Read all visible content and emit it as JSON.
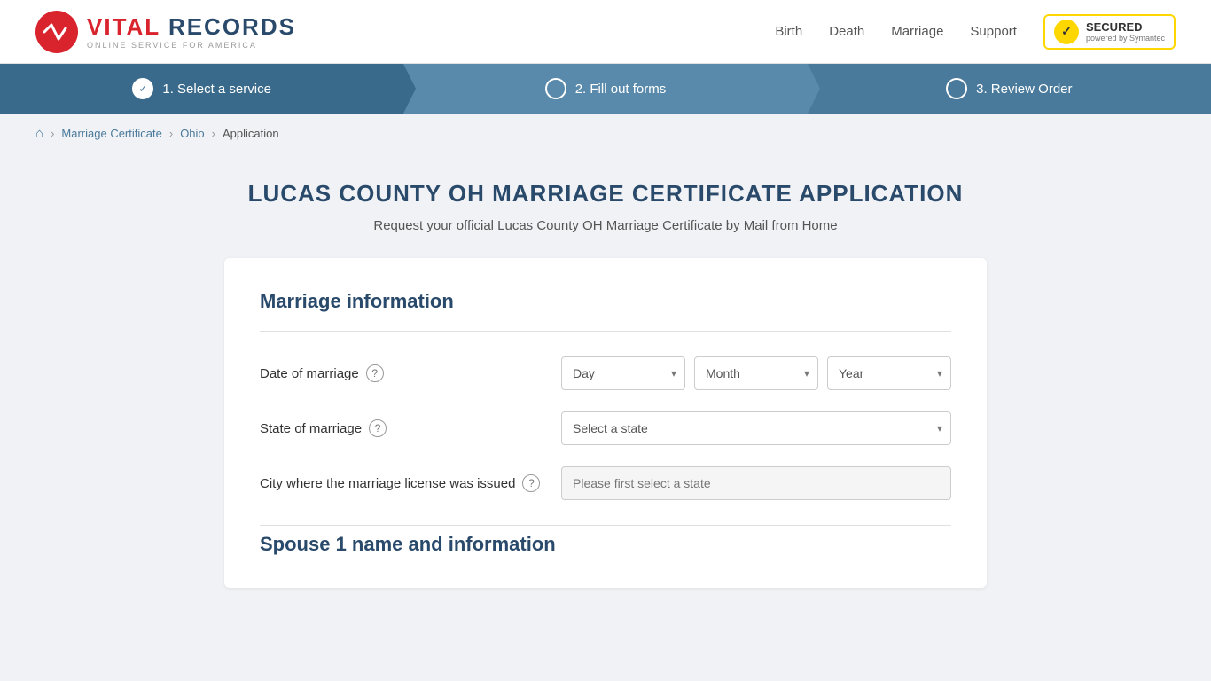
{
  "header": {
    "logo_vital": "VITAL",
    "logo_records": " RECORDS",
    "logo_sub": "ONLINE SERVICE FOR AMERICA",
    "nav_birth": "Birth",
    "nav_death": "Death",
    "nav_marriage": "Marriage",
    "nav_support": "Support",
    "norton_secured": "SECURED",
    "norton_powered": "powered by Symantec"
  },
  "progress": {
    "step1_label": "1. Select a service",
    "step2_label": "2. Fill out forms",
    "step3_label": "3. Review Order"
  },
  "breadcrumb": {
    "home_icon": "⌂",
    "sep": "›",
    "item1": "Marriage Certificate",
    "item2": "Ohio",
    "item3": "Application"
  },
  "page": {
    "title": "LUCAS COUNTY OH MARRIAGE CERTIFICATE APPLICATION",
    "subtitle": "Request your official Lucas County OH Marriage Certificate by Mail from Home"
  },
  "form": {
    "section1_title": "Marriage information",
    "date_label": "Date of marriage",
    "date_day_placeholder": "Day",
    "date_month_placeholder": "Month",
    "date_year_placeholder": "Year",
    "state_label": "State of marriage",
    "state_placeholder": "Select a state",
    "city_label": "City where the marriage license was issued",
    "city_placeholder": "Please first select a state",
    "section2_title": "Spouse 1 name and information"
  },
  "icons": {
    "help": "?",
    "checkmark": "✓",
    "chevron_down": "▾",
    "home": "⌂",
    "arrow_right": "›"
  }
}
